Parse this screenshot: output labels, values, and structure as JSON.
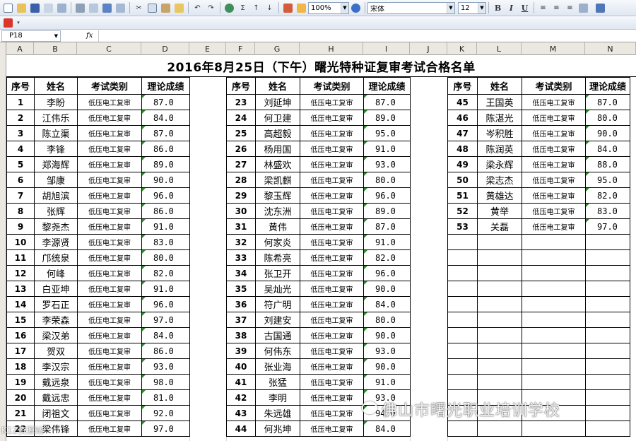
{
  "toolbar": {
    "zoom": "100%",
    "font_name": "宋体",
    "font_size": "12",
    "bold": "B",
    "italic": "I",
    "underline": "U",
    "sigma": "Σ"
  },
  "formula_bar": {
    "name_box": "P18",
    "fx": "fx",
    "formula": ""
  },
  "columns": [
    "A",
    "B",
    "C",
    "D",
    "E",
    "F",
    "G",
    "H",
    "I",
    "J",
    "K",
    "L",
    "M",
    "N"
  ],
  "sheet": {
    "title": "2016年8月25日（下午）曙光特种证复审考试合格名单",
    "headers": [
      "序号",
      "姓名",
      "考试类别",
      "理论成绩"
    ],
    "exam_type": "低压电工复审",
    "block1": [
      [
        "1",
        "李盼",
        "87.0"
      ],
      [
        "2",
        "江伟乐",
        "84.0"
      ],
      [
        "3",
        "陈立渠",
        "87.0"
      ],
      [
        "4",
        "李锋",
        "86.0"
      ],
      [
        "5",
        "郑海辉",
        "89.0"
      ],
      [
        "6",
        "邹康",
        "90.0"
      ],
      [
        "7",
        "胡旭滨",
        "96.0"
      ],
      [
        "8",
        "张辉",
        "86.0"
      ],
      [
        "9",
        "黎尧杰",
        "91.0"
      ],
      [
        "10",
        "李源贤",
        "83.0"
      ],
      [
        "11",
        "邝统泉",
        "80.0"
      ],
      [
        "12",
        "何峰",
        "82.0"
      ],
      [
        "13",
        "白亚坤",
        "91.0"
      ],
      [
        "14",
        "罗石正",
        "96.0"
      ],
      [
        "15",
        "李荣森",
        "97.0"
      ],
      [
        "16",
        "梁汉弟",
        "84.0"
      ],
      [
        "17",
        "贺双",
        "86.0"
      ],
      [
        "18",
        "李汉宗",
        "93.0"
      ],
      [
        "19",
        "戴远泉",
        "98.0"
      ],
      [
        "20",
        "戴远忠",
        "81.0"
      ],
      [
        "21",
        "闭祖文",
        "92.0"
      ],
      [
        "22",
        "梁伟锋",
        "97.0"
      ]
    ],
    "block2": [
      [
        "23",
        "刘延坤",
        "87.0"
      ],
      [
        "24",
        "何卫建",
        "89.0"
      ],
      [
        "25",
        "高超毅",
        "95.0"
      ],
      [
        "26",
        "杨用国",
        "91.0"
      ],
      [
        "27",
        "林盛欢",
        "93.0"
      ],
      [
        "28",
        "梁凯麒",
        "80.0"
      ],
      [
        "29",
        "黎玉辉",
        "96.0"
      ],
      [
        "30",
        "沈东洲",
        "89.0"
      ],
      [
        "31",
        "黄伟",
        "87.0"
      ],
      [
        "32",
        "何家炎",
        "91.0"
      ],
      [
        "33",
        "陈希亮",
        "82.0"
      ],
      [
        "34",
        "张卫开",
        "96.0"
      ],
      [
        "35",
        "吴灿光",
        "90.0"
      ],
      [
        "36",
        "符广明",
        "84.0"
      ],
      [
        "37",
        "刘建安",
        "80.0"
      ],
      [
        "38",
        "古国通",
        "90.0"
      ],
      [
        "39",
        "何伟东",
        "93.0"
      ],
      [
        "40",
        "张业海",
        "90.0"
      ],
      [
        "41",
        "张猛",
        "91.0"
      ],
      [
        "42",
        "李明",
        "93.0"
      ],
      [
        "43",
        "朱远雄",
        "94.0"
      ],
      [
        "44",
        "何兆坤",
        "84.0"
      ]
    ],
    "block3": [
      [
        "45",
        "王国英",
        "87.0"
      ],
      [
        "46",
        "陈湛光",
        "80.0"
      ],
      [
        "47",
        "岑积胜",
        "90.0"
      ],
      [
        "48",
        "陈润英",
        "84.0"
      ],
      [
        "49",
        "梁永辉",
        "88.0"
      ],
      [
        "50",
        "梁志杰",
        "95.0"
      ],
      [
        "51",
        "黄雄达",
        "82.0"
      ],
      [
        "52",
        "黄举",
        "83.0"
      ],
      [
        "53",
        "关磊",
        "97.0"
      ]
    ]
  },
  "watermark": {
    "text": "佛山市曙光职业培训学校",
    "left_text": "K12资源站"
  }
}
